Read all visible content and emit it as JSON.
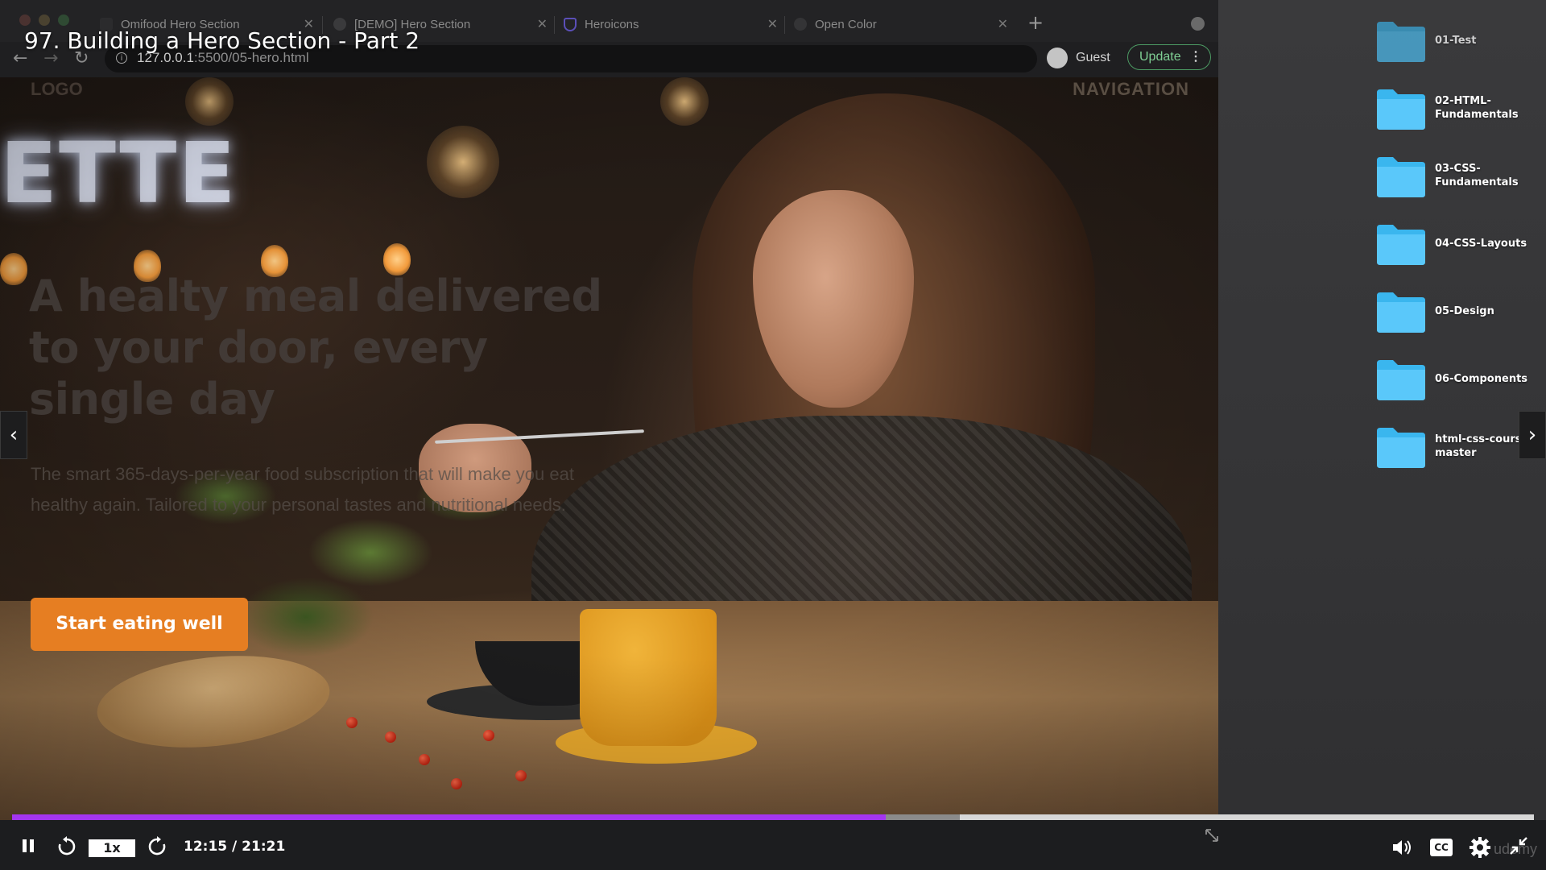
{
  "lecture": {
    "title": "97. Building a Hero Section - Part 2"
  },
  "browser": {
    "tabs": [
      {
        "label": "Omifood Hero Section",
        "active": true
      },
      {
        "label": "[DEMO] Hero Section",
        "active": false
      },
      {
        "label": "Heroicons",
        "active": false
      },
      {
        "label": "Open Color",
        "active": false
      }
    ],
    "new_tab_icon": "plus-icon",
    "url_host": "127.0.0.1",
    "url_path": ":5500/05-hero.html",
    "profile_label": "Guest",
    "update_label": "Update"
  },
  "page": {
    "logo": "LOGO",
    "navigation": "NAVIGATION",
    "hero_title": "A healty meal delivered to your door, every single day",
    "hero_description": "The smart 365-days-per-year food subscription that will make you eat healthy again. Tailored to your personal tastes and nutritional needs.",
    "cta_label": "Start eating well"
  },
  "desktop": {
    "folders": [
      {
        "name": "01-Test"
      },
      {
        "name": "02-HTML-Fundamentals"
      },
      {
        "name": "03-CSS-Fundamentals"
      },
      {
        "name": "04-CSS-Layouts"
      },
      {
        "name": "05-Design"
      },
      {
        "name": "06-Components"
      },
      {
        "name": "html-css-course-master"
      }
    ]
  },
  "player": {
    "time_display": "12:15 / 21:21",
    "speed_label": "1x",
    "progress_fraction": 0.574,
    "buffered_fraction": 0.623,
    "cc_label": "CC",
    "watermark": "udemy",
    "accent_color": "#a435f0"
  },
  "colors": {
    "cta": "#e67e22",
    "folder_blue": "#5ac8fa",
    "update_green": "#7fcf94"
  }
}
